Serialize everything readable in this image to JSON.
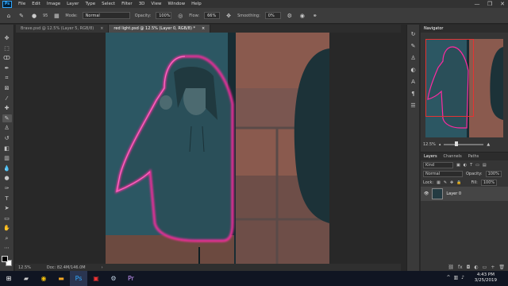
{
  "app": {
    "logo_text": "Ps"
  },
  "menu": [
    "File",
    "Edit",
    "Image",
    "Layer",
    "Type",
    "Select",
    "Filter",
    "3D",
    "View",
    "Window",
    "Help"
  ],
  "window_controls": [
    "—",
    "❐",
    "✕"
  ],
  "options_bar": {
    "brush_size": "95",
    "mode_label": "Mode:",
    "mode_value": "Normal",
    "opacity_label": "Opacity:",
    "opacity_value": "100%",
    "flow_label": "Flow:",
    "flow_value": "66%",
    "smoothing_label": "Smoothing:",
    "smoothing_value": "0%"
  },
  "tabs": [
    {
      "label": "Brave.psd @ 12.5% (Layer 5, RGB/8)",
      "close": "×"
    },
    {
      "label": "red light.psd @ 12.5% (Layer 0, RGB/8) *",
      "close": "×"
    }
  ],
  "status": {
    "zoom": "12.5%",
    "doc": "Doc: 82.4M/146.0M"
  },
  "navigator": {
    "title": "Navigator",
    "zoom": "12.5%"
  },
  "layers": {
    "tabs": [
      "Layers",
      "Channels",
      "Paths"
    ],
    "filter_kind": "Kind",
    "blend_mode": "Normal",
    "opacity_label": "Opacity:",
    "opacity_value": "100%",
    "lock_label": "Lock:",
    "fill_label": "Fill:",
    "fill_value": "100%",
    "layer_name": "Layer 0"
  },
  "taskbar": {
    "time": "4:43 PM",
    "date": "3/25/2019"
  },
  "colors": {
    "accent_pink": "#ff2aa0",
    "canvas_teal": "#2a5560",
    "bg_dark": "#282828",
    "panel": "#353535"
  }
}
